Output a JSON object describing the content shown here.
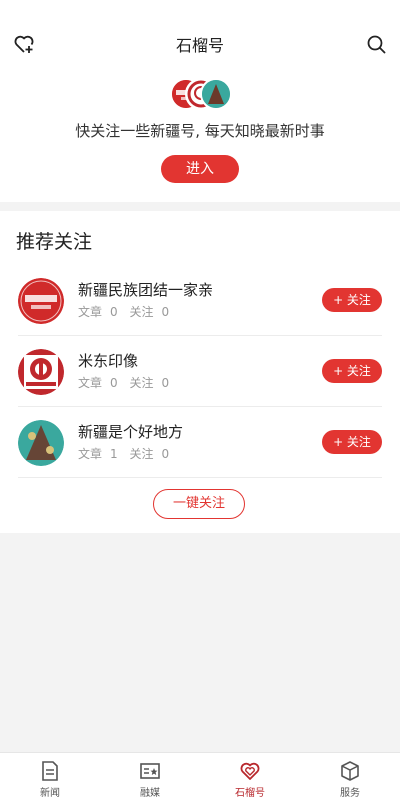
{
  "header": {
    "title": "石榴号"
  },
  "promo": {
    "text": "快关注一些新疆号, 每天知晓最新时事",
    "enter_label": "进入"
  },
  "recommend": {
    "title": "推荐关注",
    "items": [
      {
        "name": "新疆民族团结一家亲",
        "articles_label": "文章",
        "articles": "0",
        "follows_label": "关注",
        "follows": "0",
        "follow_label": "+ 关注"
      },
      {
        "name": "米东印像",
        "articles_label": "文章",
        "articles": "0",
        "follows_label": "关注",
        "follows": "0",
        "follow_label": "+ 关注"
      },
      {
        "name": "新疆是个好地方",
        "articles_label": "文章",
        "articles": "1",
        "follows_label": "关注",
        "follows": "0",
        "follow_label": "+ 关注"
      }
    ],
    "follow_all_label": "一键关注"
  },
  "tabbar": {
    "tabs": [
      {
        "label": "新闻",
        "icon": "news-icon"
      },
      {
        "label": "融媒",
        "icon": "media-icon"
      },
      {
        "label": "石榴号",
        "icon": "pomegranate-icon",
        "active": true
      },
      {
        "label": "服务",
        "icon": "service-box-icon"
      }
    ]
  },
  "colors": {
    "accent": "#e23531",
    "active_tab": "#b8282d"
  }
}
